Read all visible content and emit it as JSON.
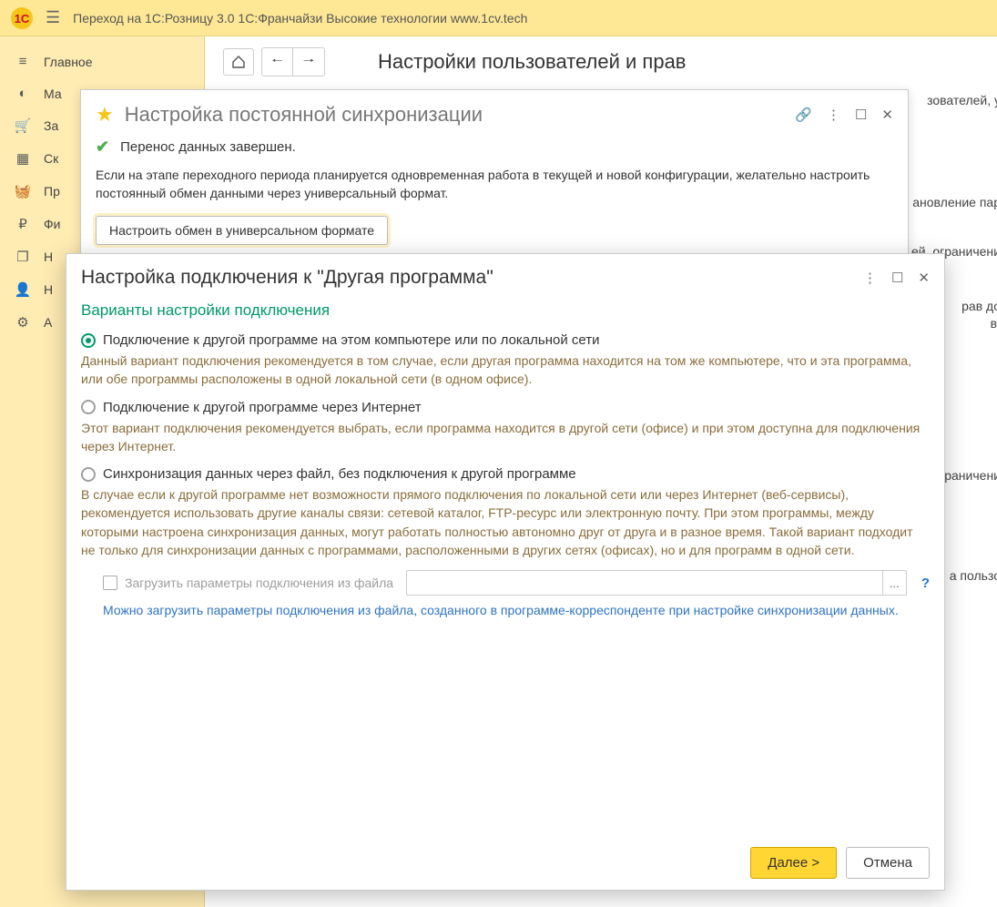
{
  "topbar": {
    "title": "Переход на 1С:Розницу 3.0  1С:Франчайзи Высокие технологии  www.1cv.tech"
  },
  "sidebar": {
    "items": [
      {
        "icon": "≡",
        "label": "Главное"
      },
      {
        "icon": "◐",
        "label": "Ма"
      },
      {
        "icon": "🛒",
        "label": "За"
      },
      {
        "icon": "▦",
        "label": "Ск"
      },
      {
        "icon": "🧺",
        "label": "Пр"
      },
      {
        "icon": "₽",
        "label": "Фи"
      },
      {
        "icon": "❐",
        "label": "Н"
      },
      {
        "icon": "👤",
        "label": "Н"
      },
      {
        "icon": "⚙",
        "label": "А"
      }
    ]
  },
  "main": {
    "page_title": "Настройки пользователей и прав",
    "bg_fragments": {
      "a": "зователей, у",
      "b": "ановление пар",
      "c": "ей, ограничени",
      "d": "рав до",
      "e": "в.",
      "f": "раничени",
      "g": "а пользо"
    }
  },
  "dialog1": {
    "title": "Настройка постоянной синхронизации",
    "status": "Перенос данных завершен.",
    "info": "Если на этапе переходного периода планируется одновременная работа в текущей и новой конфигурации, желательно настроить постоянный обмен данными через универсальный формат.",
    "button": "Настроить обмен в универсальном формате"
  },
  "dialog2": {
    "title": "Настройка подключения к \"Другая программа\"",
    "section": "Варианты настройки подключения",
    "opt1_label": "Подключение к другой программе на этом компьютере или по локальной сети",
    "opt1_desc": "Данный вариант подключения рекомендуется в том случае, если другая программа находится на том же компьютере, что и эта программа, или обе программы расположены в одной локальной сети (в одном офисе).",
    "opt2_label": "Подключение к другой программе через Интернет",
    "opt2_desc": "Этот вариант подключения рекомендуется выбрать, если программа находится в другой сети (офисе) и при этом доступна для подключения через Интернет.",
    "opt3_label": "Синхронизация данных через файл, без подключения к другой программе",
    "opt3_desc": "В случае если к другой программе нет возможности прямого подключения по локальной сети или через Интернет (веб-сервисы), рекомендуется использовать другие каналы связи: сетевой каталог, FTP-ресурс или электронную почту. При этом программы, между которыми настроена синхронизация данных, могут работать полностью автономно друг от друга и в разное время. Такой вариант подходит не только для синхронизации данных с программами, расположенными в других сетях (офисах), но и для программ в одной сети.",
    "chk_label": "Загрузить параметры подключения из файла",
    "file_btn": "...",
    "help": "?",
    "hint": "Можно загрузить параметры подключения из файла, созданного в программе-корреспонденте при настройке синхронизации данных.",
    "next": "Далее >",
    "cancel": "Отмена"
  }
}
